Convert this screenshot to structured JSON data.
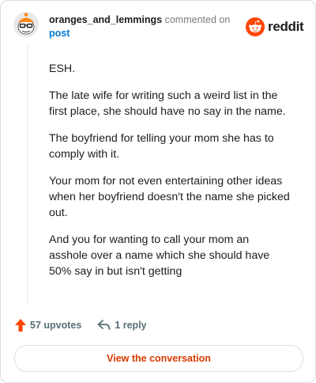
{
  "header": {
    "username": "oranges_and_lemmings",
    "action_text": "commented on",
    "post_link": "post"
  },
  "brand": {
    "wordmark": "reddit",
    "icon": "reddit-logo-icon",
    "color": "#ff4500"
  },
  "comment": {
    "paragraphs": [
      "ESH.",
      "The late wife for writing such a weird list in the first place, she should have no say in the name.",
      "The boyfriend for telling your mom she has to comply with it.",
      "Your mom for not even entertaining other ideas when her boyfriend doesn't the name she picked out.",
      "And you for wanting to call your mom an asshole over a name which she should have 50% say in but isn't getting"
    ]
  },
  "footer": {
    "upvotes_label": "57 upvotes",
    "replies_label": "1 reply",
    "upvote_color": "#ff4500"
  },
  "cta": {
    "label": "View the conversation",
    "color": "#d93a00"
  }
}
